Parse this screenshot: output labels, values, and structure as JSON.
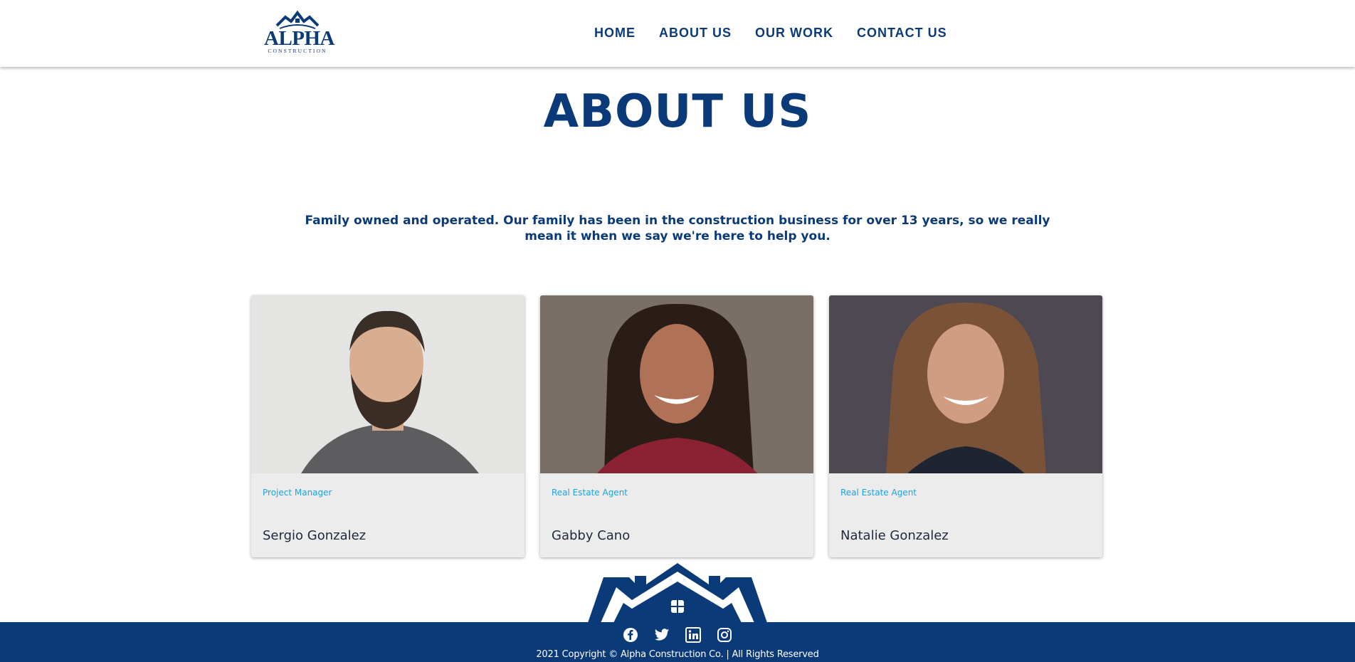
{
  "brand": {
    "logo_text": "ALPHA",
    "logo_sub": "CONSTRUCTION",
    "primary_color": "#0b3a78",
    "accent_color": "#1ea3dd"
  },
  "nav": {
    "items": [
      {
        "label": "HOME"
      },
      {
        "label": "ABOUT US"
      },
      {
        "label": "OUR WORK"
      },
      {
        "label": "CONTACT US"
      }
    ]
  },
  "page": {
    "title": "ABOUT US",
    "intro": "Family owned and operated. Our family has been in the construction business for over 13 years, so we really mean it when we say we're here to help you."
  },
  "team": [
    {
      "role": "Project Manager",
      "name": "Sergio Gonzalez",
      "photo_bg": "#e4e4e2"
    },
    {
      "role": "Real Estate Agent",
      "name": "Gabby Cano",
      "photo_bg": "#7a6f66"
    },
    {
      "role": "Real Estate Agent",
      "name": "Natalie Gonzalez",
      "photo_bg": "#4d4852"
    }
  ],
  "footer": {
    "social": [
      "facebook-icon",
      "twitter-icon",
      "linkedin-icon",
      "instagram-icon"
    ],
    "copyright": "2021 Copyright © Alpha Construction Co. | All Rights Reserved"
  }
}
